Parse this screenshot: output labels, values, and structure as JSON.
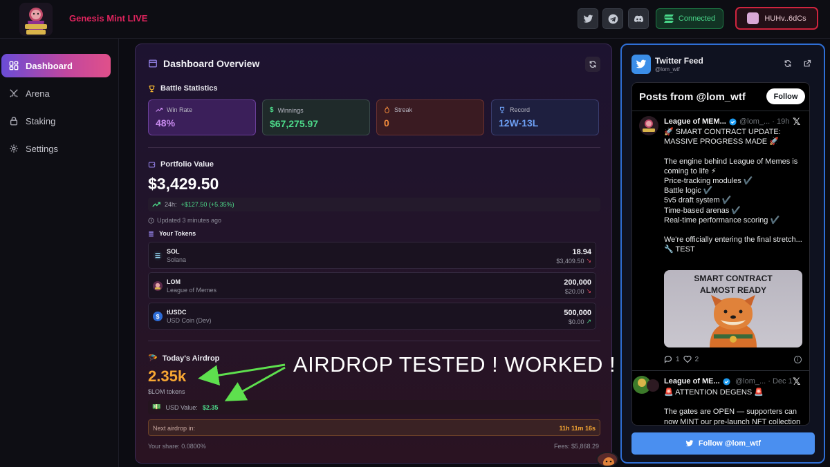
{
  "header": {
    "brand": "Genesis Mint LIVE",
    "social": [
      "twitter-icon",
      "telegram-icon",
      "discord-icon"
    ],
    "connected_label": "Connected",
    "wallet_label": "HUHv..6dCs",
    "colors": {
      "brand": "#e0245e",
      "connected": "#4ad98b",
      "wallet_border": "#d0243e"
    }
  },
  "sidebar": {
    "items": [
      {
        "label": "Dashboard",
        "icon": "grid-icon",
        "active": true
      },
      {
        "label": "Arena",
        "icon": "swords-icon",
        "active": false
      },
      {
        "label": "Staking",
        "icon": "lock-icon",
        "active": false
      },
      {
        "label": "Settings",
        "icon": "gear-icon",
        "active": false
      }
    ]
  },
  "dashboard": {
    "title": "Dashboard Overview",
    "battle_title": "Battle Statistics",
    "stats": [
      {
        "label": "Win Rate",
        "value": "48%",
        "color": "#c98bf0"
      },
      {
        "label": "Winnings",
        "value": "$67,275.97",
        "color": "#4ddb8a"
      },
      {
        "label": "Streak",
        "value": "0",
        "color": "#f28a3c"
      },
      {
        "label": "Record",
        "value": "12W-13L",
        "color": "#6ea0f5"
      }
    ],
    "portfolio": {
      "title": "Portfolio Value",
      "value": "$3,429.50",
      "change_label": "24h:",
      "change_value": "+$127.50 (+5.35%)",
      "updated": "Updated 3 minutes ago"
    },
    "tokens_title": "Your Tokens",
    "tokens": [
      {
        "symbol": "SOL",
        "name": "Solana",
        "amount": "18.94",
        "usd": "$3,409.50",
        "trend": "down"
      },
      {
        "symbol": "LOM",
        "name": "League of Memes",
        "amount": "200,000",
        "usd": "$20.00",
        "trend": "down"
      },
      {
        "symbol": "tUSDC",
        "name": "USD Coin (Dev)",
        "amount": "500,000",
        "usd": "$0.00",
        "trend": "up"
      }
    ],
    "airdrop": {
      "title": "Today's Airdrop",
      "amount": "2.35k",
      "unit": "$LOM tokens",
      "usd_label": "USD Value:",
      "usd_value": "$2.35",
      "next_label": "Next airdrop in:",
      "next_value": "11h 11m 16s",
      "share": "Your share: 0.0800%",
      "fees": "Fees: $5,868.29"
    },
    "annotation": "AIRDROP TESTED ! WORKED !"
  },
  "twitter": {
    "title": "Twitter Feed",
    "handle": "@lom_wtf",
    "feed_title": "Posts from @lom_wtf",
    "follow_label": "Follow",
    "follow_button": "Follow @lom_wtf",
    "tweets": [
      {
        "name": "League of MEM...",
        "handle": "@lom_...",
        "time": "· 19h",
        "body": "🚀 SMART CONTRACT UPDATE: MASSIVE PROGRESS MADE 🚀\n\nThe engine behind League of Memes is coming to life ⚡\nPrice-tracking modules ✔️\nBattle logic ✔️\n5v5 draft system ✔️\nTime-based arenas ✔️\nReal-time performance scoring ✔️\n\nWe're officially entering the final stretch...\n🔧 TEST",
        "image_caption": "SMART CONTRACT\nALMOST READY",
        "replies": "1",
        "likes": "2"
      },
      {
        "name": "League of ME...",
        "handle": "@lom_...",
        "time": "· Dec 1",
        "body": "🚨 ATTENTION DEGENS 🚨\n\nThe gates are OPEN — supporters can now MINT our pre-launch NFT collection"
      }
    ]
  }
}
